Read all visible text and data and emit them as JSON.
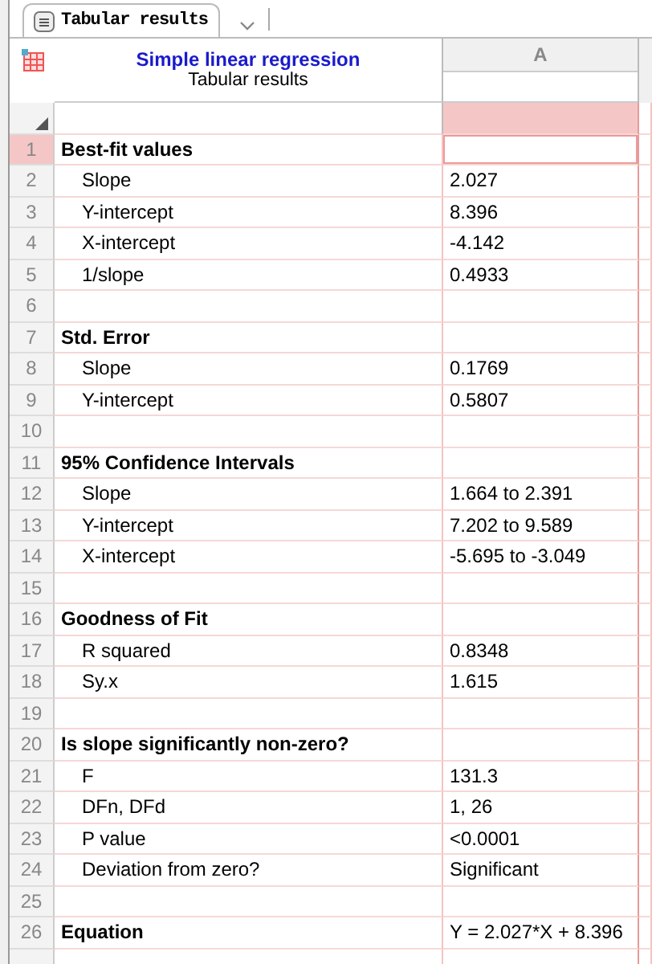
{
  "tab": {
    "label": "Tabular results",
    "selected": true
  },
  "sheet": {
    "title": "Simple linear regression",
    "subtitle": "Tabular results",
    "column": "A"
  },
  "rows": [
    {
      "number": "1",
      "kind": "heading",
      "label": "Best-fit values",
      "value": "",
      "selected": true
    },
    {
      "number": "2",
      "kind": "item",
      "label": "Slope",
      "value": "2.027",
      "selected": false
    },
    {
      "number": "3",
      "kind": "item",
      "label": "Y-intercept",
      "value": "8.396",
      "selected": false
    },
    {
      "number": "4",
      "kind": "item",
      "label": "X-intercept",
      "value": "-4.142",
      "selected": false
    },
    {
      "number": "5",
      "kind": "item",
      "label": "1/slope",
      "value": "0.4933",
      "selected": false
    },
    {
      "number": "6",
      "kind": "blank",
      "label": "",
      "value": "",
      "selected": false
    },
    {
      "number": "7",
      "kind": "heading",
      "label": "Std. Error",
      "value": "",
      "selected": false
    },
    {
      "number": "8",
      "kind": "item",
      "label": "Slope",
      "value": "0.1769",
      "selected": false
    },
    {
      "number": "9",
      "kind": "item",
      "label": "Y-intercept",
      "value": "0.5807",
      "selected": false
    },
    {
      "number": "10",
      "kind": "blank",
      "label": "",
      "value": "",
      "selected": false
    },
    {
      "number": "11",
      "kind": "heading",
      "label": "95% Confidence Intervals",
      "value": "",
      "selected": false
    },
    {
      "number": "12",
      "kind": "item",
      "label": "Slope",
      "value": "1.664 to 2.391",
      "selected": false
    },
    {
      "number": "13",
      "kind": "item",
      "label": "Y-intercept",
      "value": "7.202 to 9.589",
      "selected": false
    },
    {
      "number": "14",
      "kind": "item",
      "label": "X-intercept",
      "value": "-5.695 to -3.049",
      "selected": false
    },
    {
      "number": "15",
      "kind": "blank",
      "label": "",
      "value": "",
      "selected": false
    },
    {
      "number": "16",
      "kind": "heading",
      "label": "Goodness of Fit",
      "value": "",
      "selected": false
    },
    {
      "number": "17",
      "kind": "item",
      "label": "R squared",
      "value": "0.8348",
      "selected": false
    },
    {
      "number": "18",
      "kind": "item",
      "label": "Sy.x",
      "value": "1.615",
      "selected": false
    },
    {
      "number": "19",
      "kind": "blank",
      "label": "",
      "value": "",
      "selected": false
    },
    {
      "number": "20",
      "kind": "heading",
      "label": "Is slope significantly non-zero?",
      "value": "",
      "selected": false
    },
    {
      "number": "21",
      "kind": "item",
      "label": "F",
      "value": "131.3",
      "selected": false
    },
    {
      "number": "22",
      "kind": "item",
      "label": "DFn, DFd",
      "value": "1, 26",
      "selected": false
    },
    {
      "number": "23",
      "kind": "item",
      "label": "P value",
      "value": "<0.0001",
      "selected": false
    },
    {
      "number": "24",
      "kind": "item",
      "label": "Deviation from zero?",
      "value": "Significant",
      "selected": false
    },
    {
      "number": "25",
      "kind": "blank",
      "label": "",
      "value": "",
      "selected": false
    },
    {
      "number": "26",
      "kind": "heading",
      "label": "Equation",
      "value": "Y = 2.027*X + 8.396",
      "selected": false
    }
  ]
}
